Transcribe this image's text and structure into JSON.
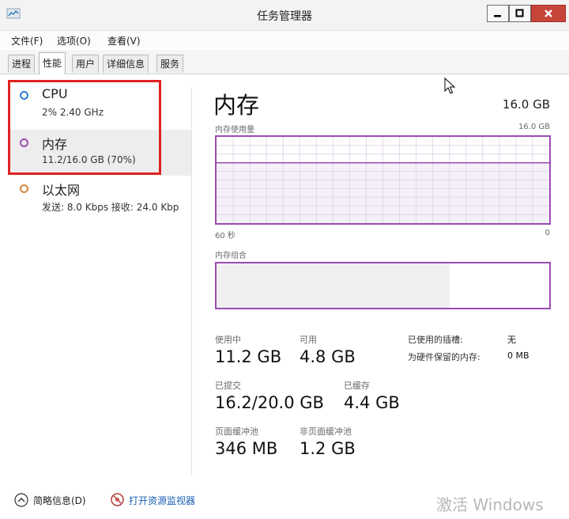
{
  "window": {
    "title": "任务管理器"
  },
  "menu": [
    "文件(F)",
    "选项(O)",
    "查看(V)"
  ],
  "tabs": [
    {
      "label": "进程",
      "active": false
    },
    {
      "label": "性能",
      "active": true
    },
    {
      "label": "用户",
      "active": false
    },
    {
      "label": "详细信息",
      "active": false
    },
    {
      "label": "服务",
      "active": false
    }
  ],
  "resources": [
    {
      "name": "CPU",
      "detail": "2% 2.40 GHz",
      "color": "#2f7fcf",
      "selected": false
    },
    {
      "name": "内存",
      "detail": "11.2/16.0 GB (70%)",
      "color": "#9b4bb0",
      "selected": true
    },
    {
      "name": "以太网",
      "detail": "发送: 8.0 Kbps 接收: 24.0 Kbp",
      "color": "#d3893a",
      "selected": false
    }
  ],
  "memory": {
    "heading": "内存",
    "total": "16.0 GB",
    "usage_label": "内存使用量",
    "usage_max": "16.0 GB",
    "time_left": "60 秒",
    "time_right": "0",
    "composition_label": "内存组合",
    "usage_fraction": 0.7,
    "composition": {
      "in_use": 0.7,
      "modified": 0.0,
      "standby": 0.275,
      "free": 0.025
    },
    "stats": {
      "in_use_label": "使用中",
      "in_use": "11.2 GB",
      "available_label": "可用",
      "available": "4.8 GB",
      "committed_label": "已提交",
      "committed": "16.2/20.0 GB",
      "cached_label": "已缓存",
      "cached": "4.4 GB",
      "paged_label": "页面缓冲池",
      "paged": "346 MB",
      "nonpaged_label": "非页面缓冲池",
      "nonpaged": "1.2 GB"
    },
    "info": {
      "slots_label": "已使用的插槽:",
      "slots": "无",
      "reserved_label": "为硬件保留的内存:",
      "reserved": "0 MB"
    }
  },
  "footer": {
    "fewer_details": "简略信息(D)",
    "open_monitor": "打开资源监视器"
  },
  "watermark": "激活 Windows",
  "colors": {
    "memory": "#9b4bb0",
    "highlight": "#e02222",
    "close": "#c7443a"
  }
}
